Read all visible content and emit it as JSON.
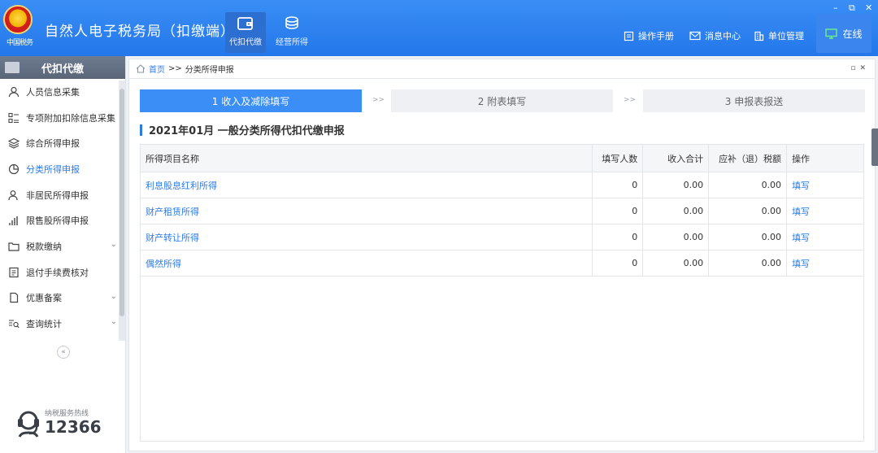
{
  "header": {
    "emblem_text": "中国税务",
    "title": "自然人电子税务局（扣缴端）",
    "nav": [
      {
        "label": "代扣代缴",
        "icon": "wallet-icon",
        "active": true
      },
      {
        "label": "经营所得",
        "icon": "coins-icon",
        "active": false
      }
    ],
    "tools": [
      {
        "label": "操作手册",
        "icon": "manual-icon"
      },
      {
        "label": "消息中心",
        "icon": "mail-icon"
      },
      {
        "label": "单位管理",
        "icon": "building-icon"
      }
    ],
    "online_label": "在线",
    "window_controls": [
      "–",
      "⧉",
      "✕"
    ]
  },
  "sidebar": {
    "title": "代扣代缴",
    "items": [
      {
        "label": "人员信息采集",
        "icon": "person-icon"
      },
      {
        "label": "专项附加扣除信息采集",
        "icon": "list-icon"
      },
      {
        "label": "综合所得申报",
        "icon": "layers-icon"
      },
      {
        "label": "分类所得申报",
        "icon": "pie-chart-icon",
        "active": true
      },
      {
        "label": "非居民所得申报",
        "icon": "user-outline-icon"
      },
      {
        "label": "限售股所得申报",
        "icon": "bar-chart-icon"
      },
      {
        "label": "税款缴纳",
        "icon": "folder-icon",
        "expandable": true
      },
      {
        "label": "退付手续费核对",
        "icon": "receipt-icon"
      },
      {
        "label": "优惠备案",
        "icon": "document-icon",
        "expandable": true
      },
      {
        "label": "查询统计",
        "icon": "search-list-icon",
        "expandable": true
      }
    ],
    "collapse_label": "«",
    "hotline_label": "纳税服务热线",
    "hotline_number": "12366"
  },
  "breadcrumb": {
    "home": "首页",
    "separator": ">>",
    "current": "分类所得申报"
  },
  "steps": [
    {
      "label": "1 收入及减除填写",
      "active": true
    },
    {
      "label": "2 附表填写",
      "active": false
    },
    {
      "label": "3 申报表报送",
      "active": false
    }
  ],
  "step_separator": ">>",
  "section_title": "2021年01月  一般分类所得代扣代缴申报",
  "table": {
    "headers": [
      "所得项目名称",
      "填写人数",
      "收入合计",
      "应补（退）税额",
      "操作"
    ],
    "rows": [
      {
        "name": "利息股息红利所得",
        "count": "0",
        "income": "0.00",
        "tax": "0.00",
        "action": "填写"
      },
      {
        "name": "财产租赁所得",
        "count": "0",
        "income": "0.00",
        "tax": "0.00",
        "action": "填写"
      },
      {
        "name": "财产转让所得",
        "count": "0",
        "income": "0.00",
        "tax": "0.00",
        "action": "填写"
      },
      {
        "name": "偶然所得",
        "count": "0",
        "income": "0.00",
        "tax": "0.00",
        "action": "填写"
      }
    ]
  },
  "colors": {
    "accent": "#2b7be9",
    "topbar": "#2f82ef",
    "active_step": "#3a8ef5"
  }
}
